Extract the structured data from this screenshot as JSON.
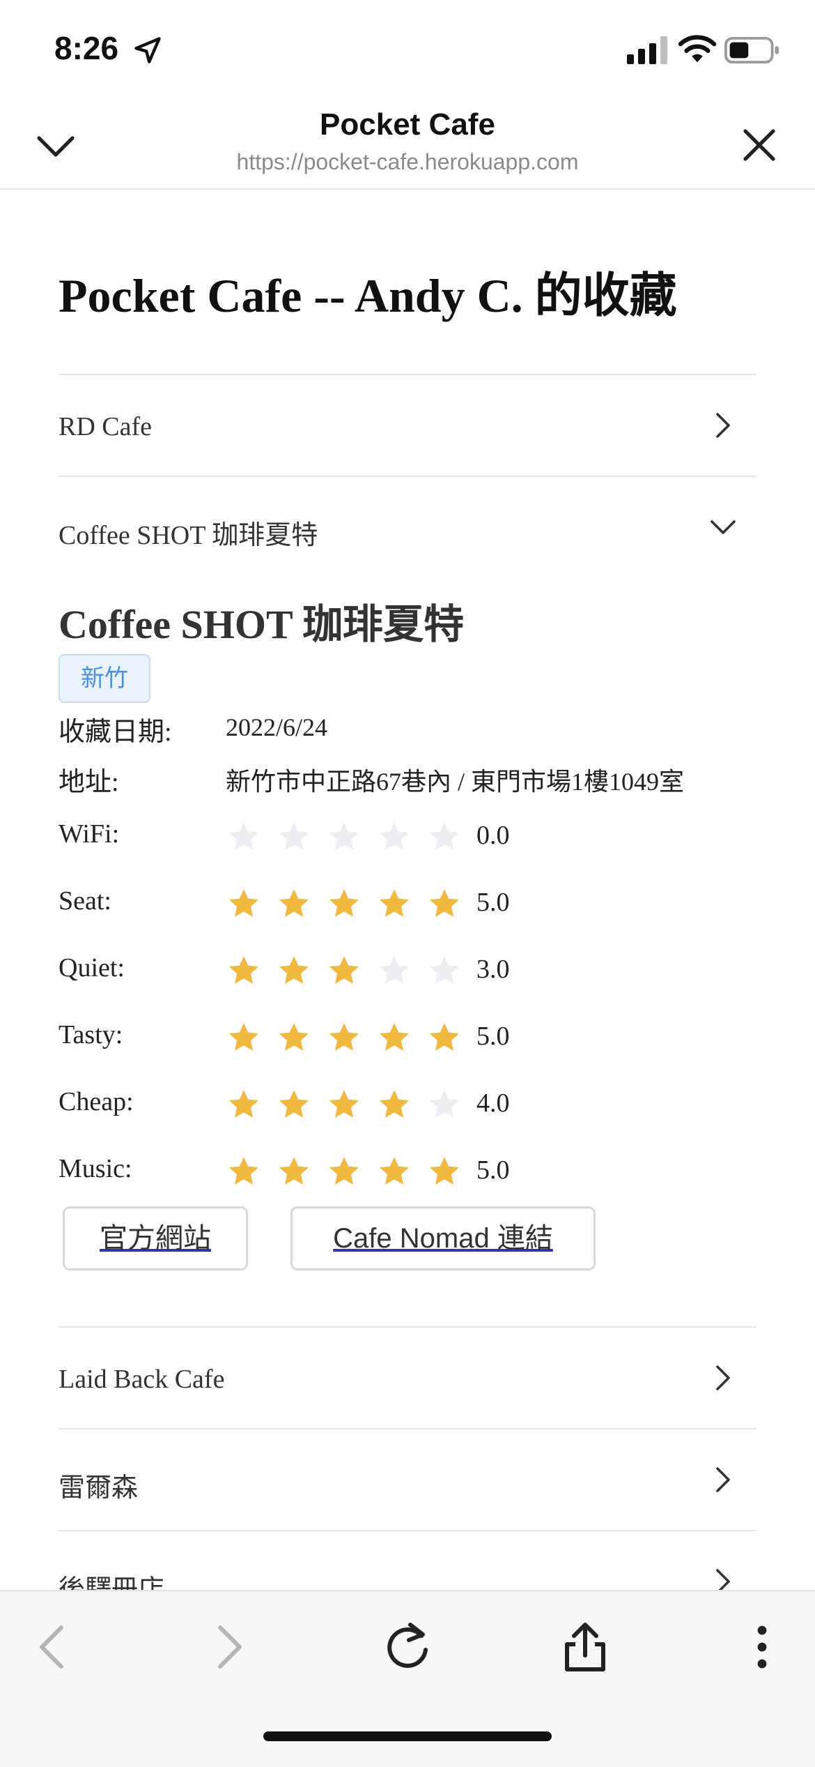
{
  "status_bar": {
    "time": "8:26"
  },
  "browser": {
    "title": "Pocket Cafe",
    "url": "https://pocket-cafe.herokuapp.com"
  },
  "page": {
    "title": "Pocket Cafe -- Andy C. 的收藏"
  },
  "list": {
    "items": [
      {
        "label": "RD Cafe",
        "expanded": false
      },
      {
        "label": "Coffee SHOT 珈琲夏特",
        "expanded": true
      },
      {
        "label": "Laid Back Cafe",
        "expanded": false
      },
      {
        "label": "雷爾森",
        "expanded": false
      },
      {
        "label": "後驛冊店",
        "expanded": false
      }
    ]
  },
  "detail": {
    "name": "Coffee SHOT 珈琲夏特",
    "tag": "新竹",
    "saved_date_label": "收藏日期:",
    "saved_date": "2022/6/24",
    "address_label": "地址:",
    "address": "新竹市中正路67巷內 / 東門市場1樓1049室",
    "ratings": [
      {
        "label": "WiFi:",
        "value": 0,
        "display": "0.0"
      },
      {
        "label": "Seat:",
        "value": 5,
        "display": "5.0"
      },
      {
        "label": "Quiet:",
        "value": 3,
        "display": "3.0"
      },
      {
        "label": "Tasty:",
        "value": 5,
        "display": "5.0"
      },
      {
        "label": "Cheap:",
        "value": 4,
        "display": "4.0"
      },
      {
        "label": "Music:",
        "value": 5,
        "display": "5.0"
      }
    ],
    "buttons": {
      "official_site": "官方網站",
      "nomad_link": "Cafe Nomad 連結"
    }
  },
  "colors": {
    "star_filled": "#f0b83e",
    "star_empty": "#eceef1",
    "tag_text": "#4a90e2"
  }
}
